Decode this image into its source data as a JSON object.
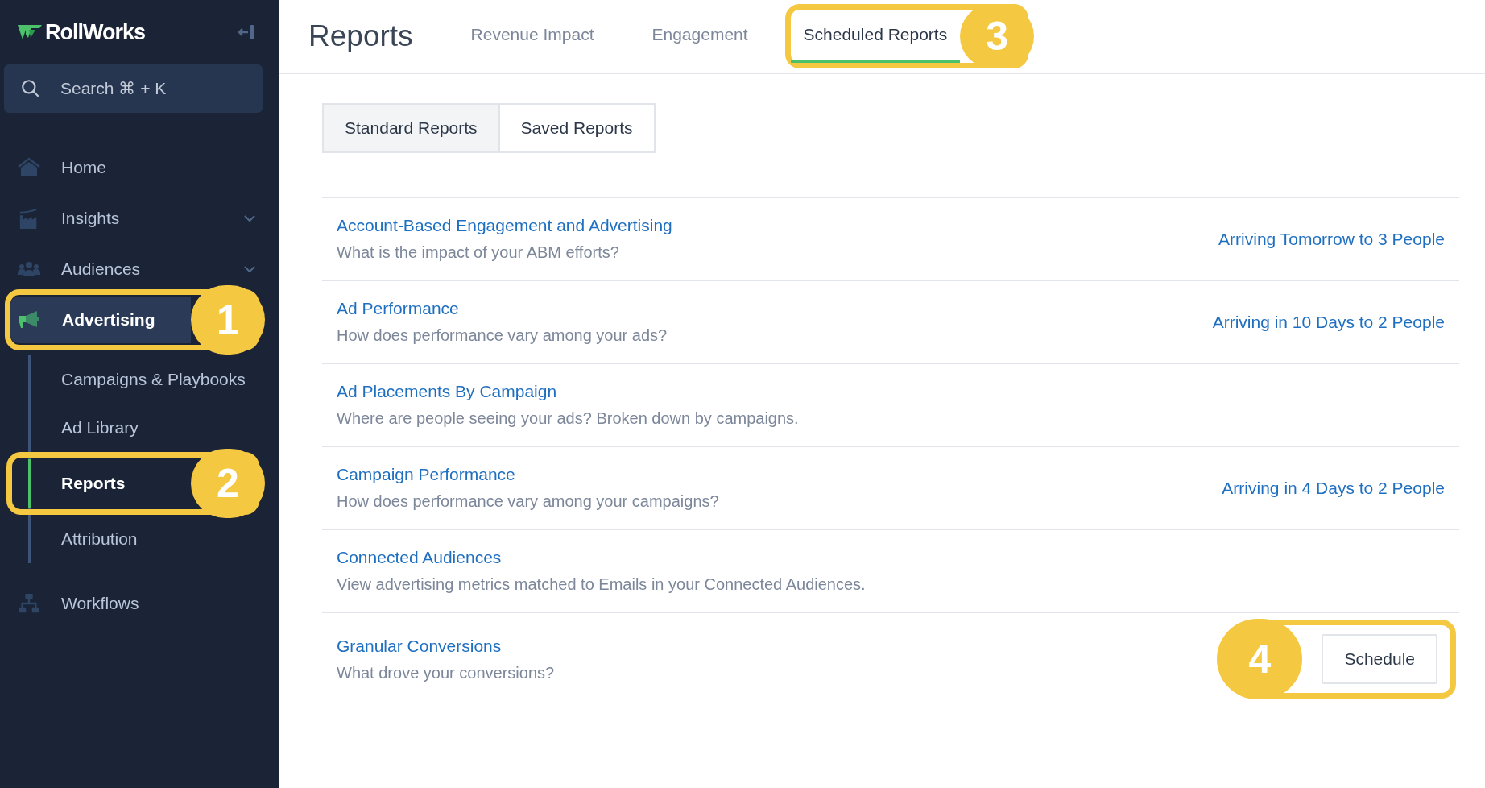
{
  "sidebar": {
    "brand": "RollWorks",
    "search": {
      "placeholder": "Search ⌘ + K"
    },
    "nav": [
      {
        "label": "Home",
        "kind": "home",
        "collapsible": false,
        "selected": false
      },
      {
        "label": "Insights",
        "kind": "chart",
        "collapsible": true,
        "selected": false
      },
      {
        "label": "Audiences",
        "kind": "people",
        "collapsible": true,
        "selected": false
      },
      {
        "label": "Advertising",
        "kind": "megaphone",
        "collapsible": false,
        "selected": true,
        "callout": "1",
        "children": [
          {
            "label": "Campaigns & Playbooks",
            "selected": false
          },
          {
            "label": "Ad Library",
            "selected": false
          },
          {
            "label": "Reports",
            "selected": true,
            "callout": "2"
          },
          {
            "label": "Attribution",
            "selected": false
          }
        ]
      },
      {
        "label": "Workflows",
        "kind": "sitemap",
        "collapsible": false,
        "selected": false
      }
    ]
  },
  "header": {
    "title": "Reports",
    "tabs": [
      {
        "label": "Revenue Impact",
        "selected": false
      },
      {
        "label": "Engagement",
        "selected": false
      },
      {
        "label": "Scheduled Reports",
        "selected": true,
        "callout": "3"
      }
    ]
  },
  "segments": [
    {
      "label": "Standard Reports",
      "selected": true
    },
    {
      "label": "Saved Reports",
      "selected": false
    }
  ],
  "reports": [
    {
      "title": "Account-Based Engagement and Advertising",
      "description": "What is the impact of your ABM efforts?",
      "status": "Arriving Tomorrow to 3 People"
    },
    {
      "title": "Ad Performance",
      "description": "How does performance vary among your ads?",
      "status": "Arriving in 10 Days to 2 People"
    },
    {
      "title": "Ad Placements By Campaign",
      "description": "Where are people seeing your ads? Broken down by campaigns."
    },
    {
      "title": "Campaign Performance",
      "description": "How does performance vary among your campaigns?",
      "status": "Arriving in 4 Days to 2 People"
    },
    {
      "title": "Connected Audiences",
      "description": "View advertising metrics matched to Emails in your Connected Audiences."
    },
    {
      "title": "Granular Conversions",
      "description": "What drove your conversions?",
      "action": "Schedule",
      "callout": "4"
    }
  ]
}
